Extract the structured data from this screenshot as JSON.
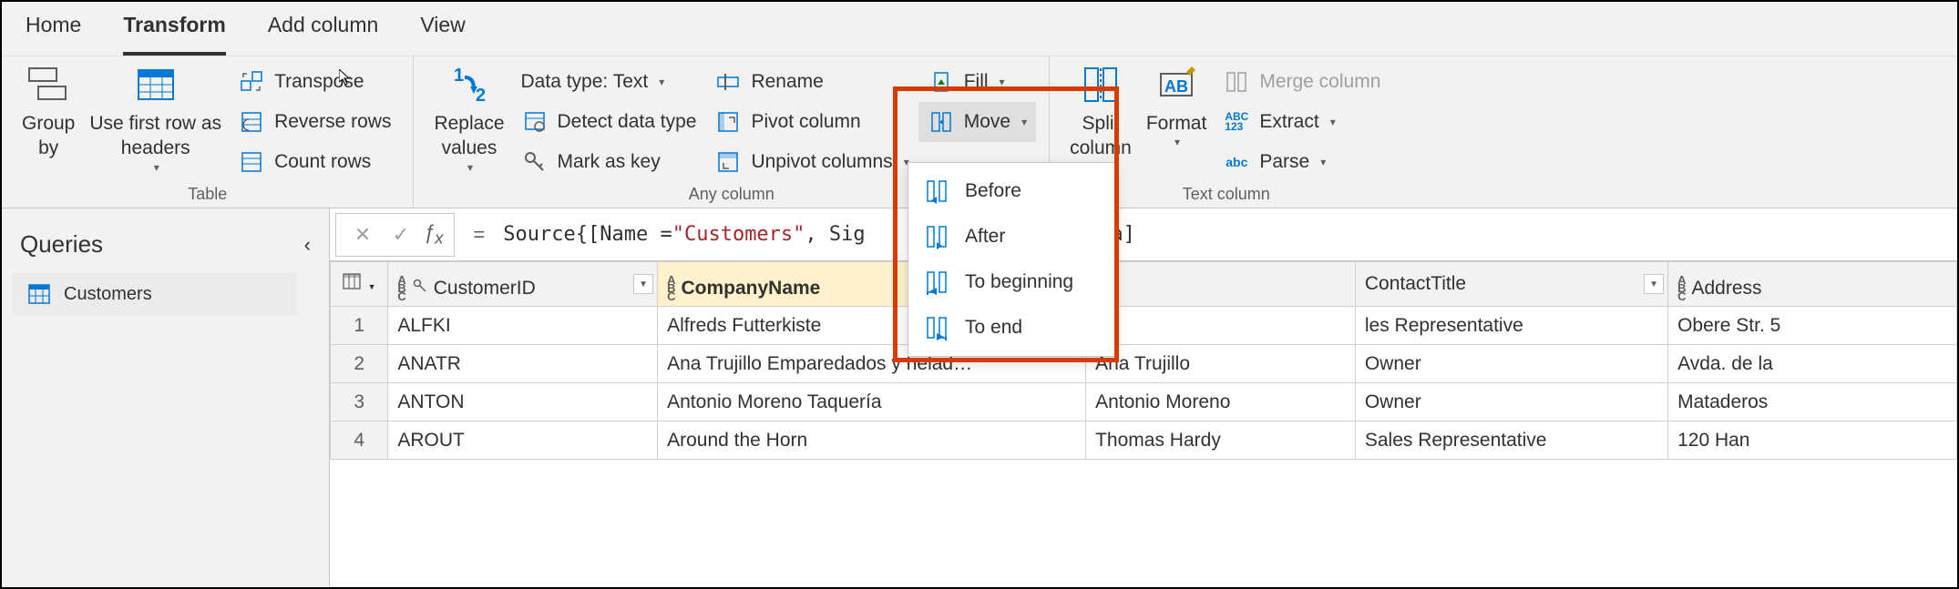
{
  "tabs": {
    "home": "Home",
    "transform": "Transform",
    "add_column": "Add column",
    "view": "View"
  },
  "ribbon": {
    "table_group": {
      "label": "Table",
      "group_by": "Group\nby",
      "use_first_row": "Use first row as\nheaders",
      "transpose": "Transpose",
      "reverse_rows": "Reverse rows",
      "count_rows": "Count rows"
    },
    "any_column_group": {
      "label": "Any column",
      "replace_values": "Replace\nvalues",
      "data_type": "Data type: Text",
      "detect": "Detect data type",
      "mark_as_key": "Mark as key",
      "rename": "Rename",
      "pivot": "Pivot column",
      "unpivot": "Unpivot columns",
      "fill": "Fill",
      "move": "Move"
    },
    "text_column_group": {
      "label": "Text column",
      "split_column": "Split\ncolumn",
      "format": "Format",
      "merge_columns": "Merge column",
      "extract": "Extract",
      "parse": "Parse"
    }
  },
  "move_menu": {
    "before": "Before",
    "after": "After",
    "to_beginning": "To beginning",
    "to_end": "To end"
  },
  "queries": {
    "title": "Queries",
    "items": [
      "Customers"
    ]
  },
  "formula": {
    "prefix": "Source{[Name = ",
    "string": "\"Customers\"",
    "mid": ", Sig",
    "suffix": "Data]"
  },
  "grid": {
    "columns": [
      "CustomerID",
      "CompanyName",
      "",
      "ContactTitle",
      "Address"
    ],
    "column3_partial": "",
    "rows": [
      {
        "n": "1",
        "id": "ALFKI",
        "company": "Alfreds Futterkiste",
        "contact": "",
        "title": "les Representative",
        "addr": "Obere Str. 5"
      },
      {
        "n": "2",
        "id": "ANATR",
        "company": "Ana Trujillo Emparedados y helad…",
        "contact": "Ana Trujillo",
        "title": "Owner",
        "addr": "Avda. de la"
      },
      {
        "n": "3",
        "id": "ANTON",
        "company": "Antonio Moreno Taquería",
        "contact": "Antonio Moreno",
        "title": "Owner",
        "addr": "Mataderos"
      },
      {
        "n": "4",
        "id": "AROUT",
        "company": "Around the Horn",
        "contact": "Thomas Hardy",
        "title": "Sales Representative",
        "addr": "120 Han"
      }
    ]
  }
}
